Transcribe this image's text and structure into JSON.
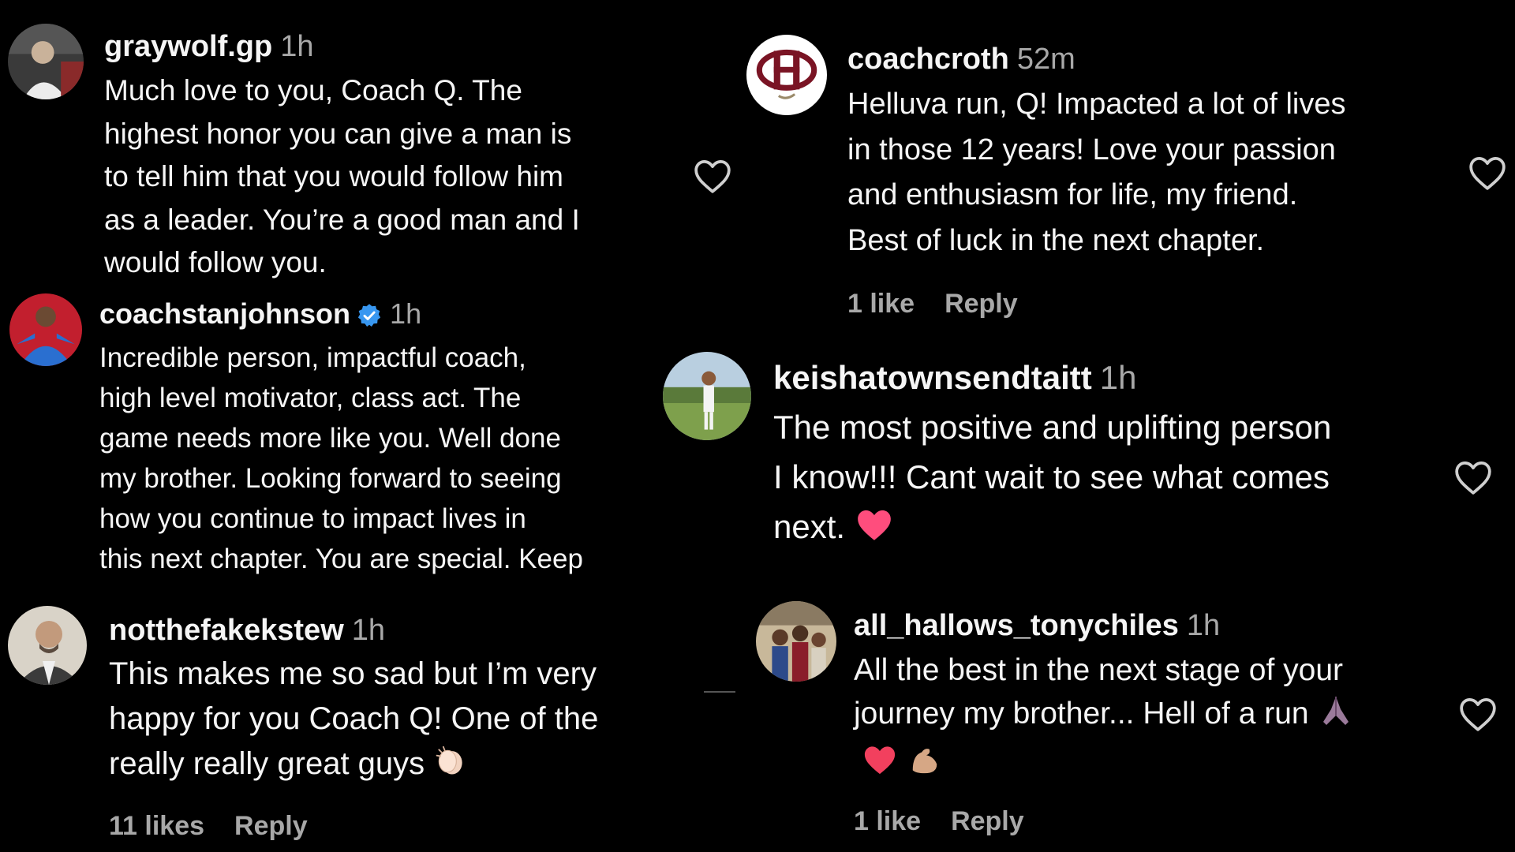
{
  "colors": {
    "background": "#000000",
    "text": "#f5f5f5",
    "muted": "#a8a8a8",
    "verified": "#3897f0",
    "heart_emoji": "#ff4d7d"
  },
  "comments": [
    {
      "username": "graywolf.gp",
      "time": "1h",
      "lines": [
        "Much love to you, Coach Q. The",
        "highest honor you can give a man is",
        "to tell him that you would follow him",
        "as a leader. You’re a good man and I",
        "would follow you."
      ],
      "icon": "heart-outline-icon"
    },
    {
      "username": "coachstanjohnson",
      "verified": true,
      "time": "1h",
      "lines": [
        "Incredible person, impactful coach,",
        "high level motivator, class act. The",
        "game needs more like you. Well done",
        "my brother. Looking forward to seeing",
        "how you continue to impact lives in",
        "this next chapter. You are special. Keep"
      ]
    },
    {
      "username": "notthefakekstew",
      "time": "1h",
      "lines": [
        "This makes me so sad but I’m very",
        "happy for you Coach Q! One of the",
        "really really great guys"
      ],
      "likes": "11 likes",
      "reply": "Reply"
    },
    {
      "username": "coachcroth",
      "time": "52m",
      "lines": [
        "Helluva run, Q! Impacted a lot of lives",
        "in those 12 years! Love your passion",
        "and enthusiasm for life, my friend.",
        "Best of luck in the next chapter."
      ],
      "likes": "1 like",
      "reply": "Reply"
    },
    {
      "username": "keishatownsendtaitt",
      "time": "1h",
      "lines": [
        "The most positive and uplifting person",
        "I know!!! Cant wait to see what comes",
        "next."
      ]
    },
    {
      "username": "all_hallows_tonychiles",
      "time": "1h",
      "lines": [
        "All the best in the next stage of your",
        "journey my brother... Hell of a run"
      ],
      "likes": "1 like",
      "reply": "Reply"
    }
  ]
}
